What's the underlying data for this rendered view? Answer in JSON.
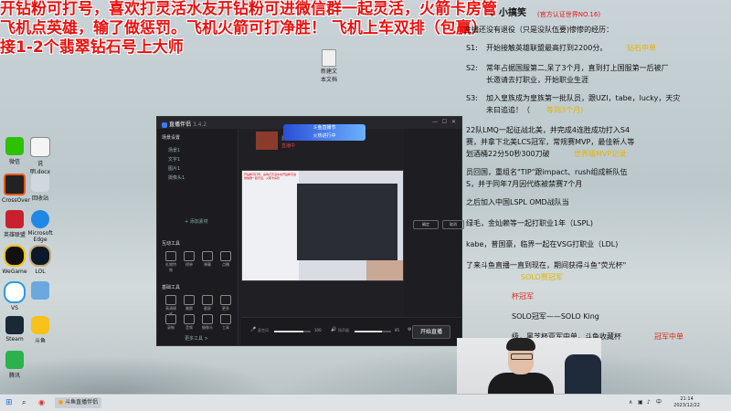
{
  "overlay": {
    "line1": "开钻粉可打号，喜欢打灵活水友开钻粉可进微信群一起灵活，火箭卡房管",
    "line2": "飞机点英雄，输了做惩罚。飞机火箭可打净胜！ 飞机上车双排（包赢）",
    "line3": "接1-2个翡翠钻石号上大师"
  },
  "profile": {
    "name": "、小搞笑",
    "tag": "(官方认证世界NO.16)",
    "intro": "主播还没有退役（只是没队伍要)惨惨的经历：",
    "s1_label": "S1:",
    "s1": "开始接触英雄联盟最高打到2200分。",
    "s1_hl": "钻石中单",
    "s2_label": "S2:",
    "s2a": "常年占据国服第二,呆了3个月，直到打上国服第一后被厂",
    "s2b": "长邀请去打职业，开始职业生涯",
    "s3_label": "S3:",
    "s3a": "加入皇族成为皇族第一批队员，跟UZI，tabe，lucky，天灾",
    "s3b": "未曰追追！（",
    "s3b_tail": "等到3个月)",
    "l7": "22队LMQ一起征战北美，并完成4连胜成功打入S4",
    "l8": "赛，并拿下北美LCS冠军，常规赛MVP，最佳新人等",
    "l9": "划酒桶22分50秒300刀破",
    "l9_hl": "世界级MVP记录",
    "l10": "员回国，重组名\"TIP\"跟impact、rush组成新队伍",
    "l11": "S，并于同年7月因代练被禁赛7个月",
    "l12": "之后加入中国LSPL OMD战队当",
    "l13": "绿毛，金灿赖等一起打职业1年（LSPL)",
    "l14": "kabe，普国豪，临界一起在VSG打职业（LDL)",
    "l15": "了来斗鱼直播一直到现在，期间获得斗鱼\"荧光杯\"",
    "l15b": "SOLO赛冠军",
    "l16": "杯冠军",
    "l17": "SOLO冠军——SOLO King",
    "l18": "级，黑芝杯亚军中单，斗鱼收藏杯",
    "l18_hl": "冠军中单"
  },
  "desktop": {
    "file_label": "新建文本文档",
    "icons": [
      "微信",
      "说明.docx",
      "CrossOver",
      "回收站",
      "英雄联盟",
      "Microsoft Edge",
      "WeGame",
      "LOL",
      "VS",
      "Steam",
      "斗鱼",
      "腾讯"
    ]
  },
  "app": {
    "title": "直播伴侣",
    "version": "3.4.2",
    "scene_header": "场景设置",
    "scenes": [
      "场景1",
      "文字1",
      "图片1",
      "摄像头1"
    ],
    "add_source": "+ 添加素材",
    "tools_header": "互动工具",
    "tools": [
      "礼物特效",
      "榜单",
      "弹幕",
      "点播"
    ],
    "basic_header": "基础工具",
    "basic": [
      "高清模式",
      "美颜",
      "截屏",
      "更多",
      "录制",
      "音频",
      "摄像头",
      "工具"
    ],
    "more_tools": "更多工具 >",
    "rank_label": "游戏直播",
    "status": "直播中",
    "mic_label": "麦克风",
    "mic_value": "100",
    "speaker_label": "扬声器",
    "speaker_value": "85",
    "settings_label": "设置",
    "start_live": "开始直播",
    "banner_line1": "斗鱼直播节",
    "banner_line2": "火热进行中",
    "confirm": "确定",
    "cancel": "取消"
  },
  "taskbar": {
    "search": "搜索",
    "active_app": "斗鱼直播伴侣",
    "time": "21:14",
    "date": "2023/12/22"
  }
}
